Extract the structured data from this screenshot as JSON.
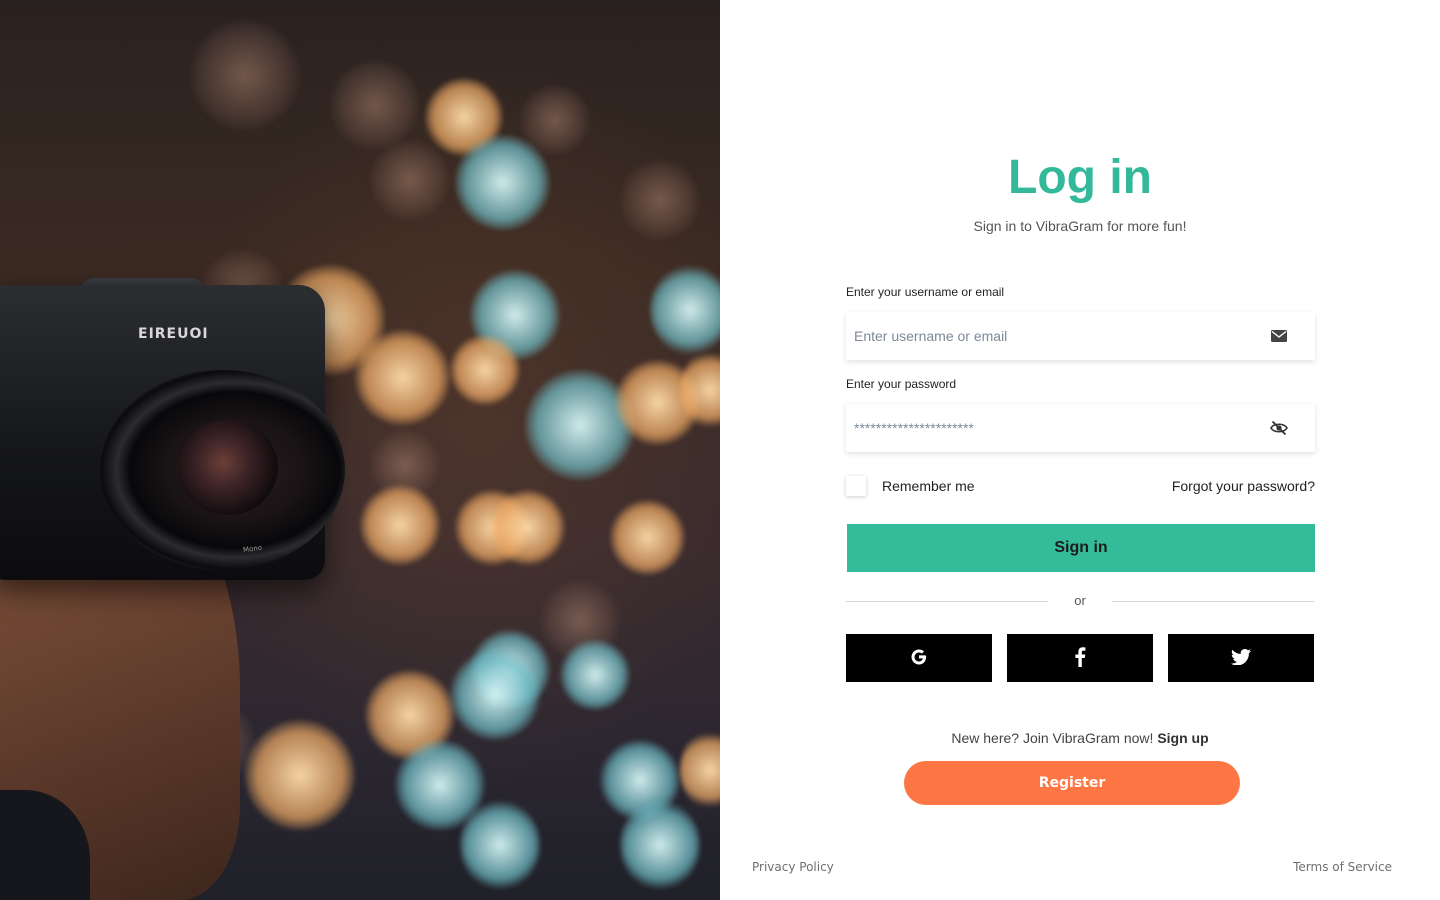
{
  "photo": {
    "camera_brand": "EIREUOI",
    "lens_text": "Mono"
  },
  "login": {
    "title": "Log in",
    "subtitle": "Sign in to VibraGram for more fun!",
    "username": {
      "label": "Enter your username or email",
      "placeholder": "Enter username or email",
      "value": "",
      "icon": "envelope-icon"
    },
    "password": {
      "label": "Enter your password",
      "placeholder": "**********************",
      "value": "",
      "icon": "eye-slash-icon"
    },
    "remember_label": "Remember me",
    "remember_checked": false,
    "forgot_label": "Forgot your password?",
    "signin_label": "Sign in",
    "divider_label": "or",
    "social": [
      {
        "name": "google",
        "icon": "google-icon"
      },
      {
        "name": "facebook",
        "icon": "facebook-icon"
      },
      {
        "name": "twitter",
        "icon": "twitter-icon"
      }
    ],
    "signup_prompt": "New here? Join VibraGram now!",
    "signup_link": "Sign up",
    "register_label": "Register"
  },
  "footer": {
    "privacy": "Privacy Policy",
    "terms": "Terms of Service"
  },
  "colors": {
    "accent": "#33b89a",
    "register": "#ff7645",
    "social_bg": "#000000"
  }
}
